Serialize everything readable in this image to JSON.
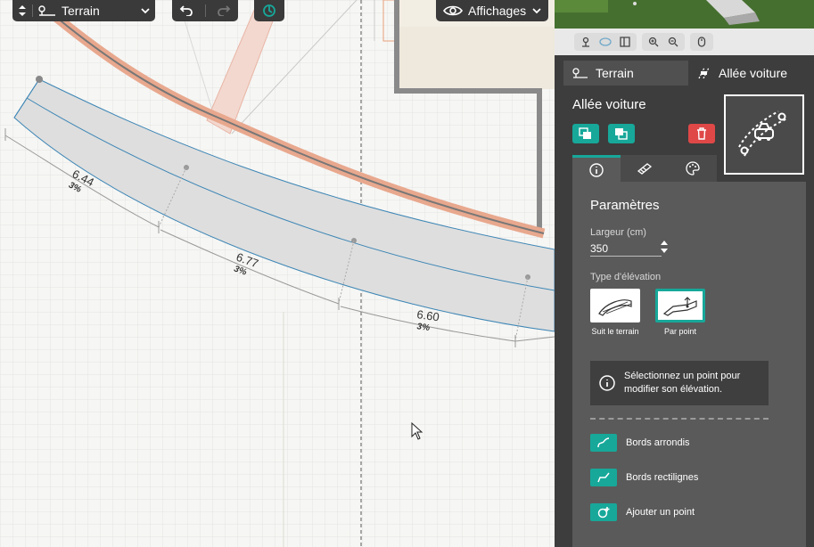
{
  "toolbar": {
    "layer_selector": {
      "label": "Terrain"
    },
    "display_button": {
      "label": "Affichages"
    }
  },
  "canvas": {
    "dimensions": [
      {
        "length": "6.44",
        "slope": "3%"
      },
      {
        "length": "6.77",
        "slope": "3%"
      },
      {
        "length": "6.60",
        "slope": "3%"
      }
    ]
  },
  "panel": {
    "tabs": [
      {
        "label": "Terrain",
        "icon": "terrain-icon"
      },
      {
        "label": "Allée voiture",
        "icon": "driveway-icon"
      }
    ],
    "title": "Allée voiture",
    "settings": {
      "title": "Paramètres",
      "width_label": "Largeur (cm)",
      "width_value": "350",
      "elevation_label": "Type d'élévation",
      "elevation_options": [
        {
          "label": "Suit le terrain",
          "selected": false
        },
        {
          "label": "Par point",
          "selected": true
        }
      ],
      "info_text": "Sélectionnez un point pour modifier son élévation.",
      "actions": [
        {
          "label": "Bords arrondis"
        },
        {
          "label": "Bords rectilignes"
        },
        {
          "label": "Ajouter un point"
        }
      ]
    },
    "colors": {
      "accent": "#17a89a",
      "delete": "#e04848",
      "panel_bg": "#3d3d3d",
      "settings_bg": "#5a5a5a"
    }
  }
}
